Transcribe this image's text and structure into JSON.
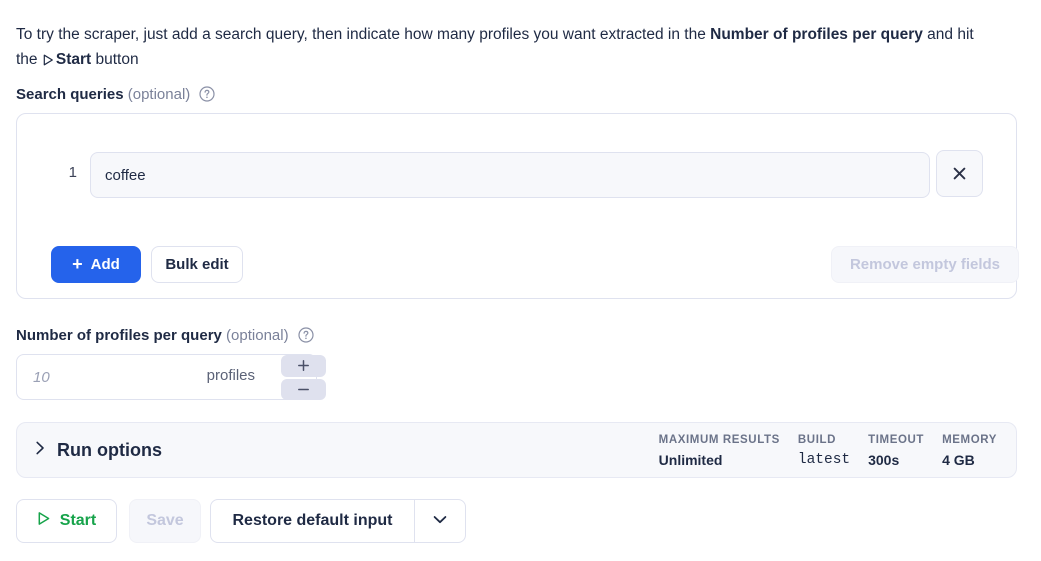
{
  "intro": {
    "part1": "To try the scraper, just add a search query, then indicate how many profiles you want extracted in the ",
    "bold1": "Number of profiles per query",
    "part2": " and hit the ",
    "bold2": "Start",
    "part3": " button",
    "play_icon": "play-triangle-icon"
  },
  "search_queries": {
    "label": "Search queries",
    "optional": "(optional)",
    "help_icon": "help-circle-icon",
    "rows": [
      {
        "index": "1",
        "value": "coffee",
        "remove_icon": "close-x-icon"
      }
    ],
    "add_label": "Add",
    "add_icon": "plus-icon",
    "bulk_edit_label": "Bulk edit",
    "remove_empty_label": "Remove empty fields"
  },
  "profiles_per_query": {
    "label": "Number of profiles per query",
    "optional": "(optional)",
    "help_icon": "help-circle-icon",
    "value": "",
    "placeholder": "10",
    "unit": "profiles",
    "increment_icon": "plus-icon",
    "decrement_icon": "minus-icon"
  },
  "run_options": {
    "title": "Run options",
    "expand_icon": "chevron-right-icon",
    "stats": [
      {
        "label": "MAXIMUM RESULTS",
        "value": "Unlimited",
        "mono": false
      },
      {
        "label": "BUILD",
        "value": "latest",
        "mono": true
      },
      {
        "label": "TIMEOUT",
        "value": "300s",
        "mono": false
      },
      {
        "label": "MEMORY",
        "value": "4 GB",
        "mono": false
      }
    ]
  },
  "actions": {
    "start_label": "Start",
    "start_icon": "play-triangle-icon",
    "save_label": "Save",
    "restore_label": "Restore default input",
    "restore_caret_icon": "chevron-down-icon"
  },
  "colors": {
    "accent_blue": "#2563eb",
    "start_green": "#16a34a",
    "border": "#dfe2ef",
    "disabled_text": "#c3c7dd",
    "panel_bg": "#f7f8fb"
  }
}
